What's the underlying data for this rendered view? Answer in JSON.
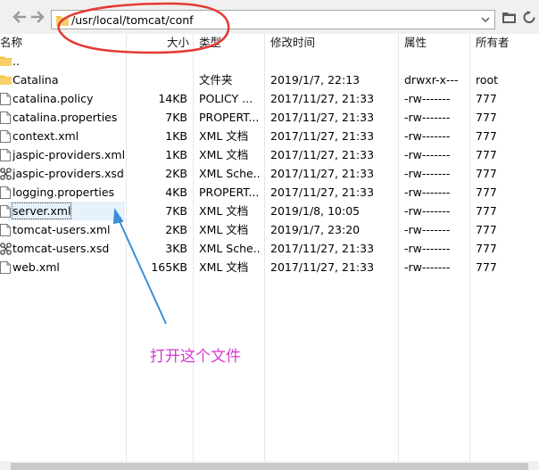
{
  "toolbar": {
    "back_icon": "arrow-left-icon",
    "forward_icon": "arrow-right-icon",
    "path": "/usr/local/tomcat/conf",
    "folder_icon": "folder-icon",
    "dropdown_icon": "chevron-down-icon",
    "browse_icon": "open-folder-icon",
    "refresh_icon": "refresh-icon"
  },
  "columns": {
    "name": "名称",
    "size": "大小",
    "type": "类型",
    "modified": "修改时间",
    "attributes": "属性",
    "owner": "所有者"
  },
  "files": [
    {
      "icon": "folder-icon",
      "name": "..",
      "size": "",
      "type": "",
      "modified": "",
      "attributes": "",
      "owner": ""
    },
    {
      "icon": "folder-icon",
      "name": "Catalina",
      "size": "",
      "type": "文件夹",
      "modified": "2019/1/7, 22:13",
      "attributes": "drwxr-x---",
      "owner": "root"
    },
    {
      "icon": "file-icon",
      "name": "catalina.policy",
      "size": "14KB",
      "type": "POLICY ...",
      "modified": "2017/11/27, 21:33",
      "attributes": "-rw-------",
      "owner": "777"
    },
    {
      "icon": "file-icon",
      "name": "catalina.properties",
      "size": "7KB",
      "type": "PROPERT...",
      "modified": "2017/11/27, 21:33",
      "attributes": "-rw-------",
      "owner": "777"
    },
    {
      "icon": "file-icon",
      "name": "context.xml",
      "size": "1KB",
      "type": "XML 文档",
      "modified": "2017/11/27, 21:33",
      "attributes": "-rw-------",
      "owner": "777"
    },
    {
      "icon": "file-icon",
      "name": "jaspic-providers.xml",
      "size": "1KB",
      "type": "XML 文档",
      "modified": "2017/11/27, 21:33",
      "attributes": "-rw-------",
      "owner": "777"
    },
    {
      "icon": "xsd-file-icon",
      "name": "jaspic-providers.xsd",
      "size": "2KB",
      "type": "XML Sche...",
      "modified": "2017/11/27, 21:33",
      "attributes": "-rw-------",
      "owner": "777"
    },
    {
      "icon": "file-icon",
      "name": "logging.properties",
      "size": "4KB",
      "type": "PROPERT...",
      "modified": "2017/11/27, 21:33",
      "attributes": "-rw-------",
      "owner": "777"
    },
    {
      "icon": "file-icon",
      "name": "server.xml",
      "size": "7KB",
      "type": "XML 文档",
      "modified": "2019/1/8, 10:05",
      "attributes": "-rw-------",
      "owner": "777"
    },
    {
      "icon": "file-icon",
      "name": "tomcat-users.xml",
      "size": "2KB",
      "type": "XML 文档",
      "modified": "2019/1/7, 23:20",
      "attributes": "-rw-------",
      "owner": "777"
    },
    {
      "icon": "xsd-file-icon",
      "name": "tomcat-users.xsd",
      "size": "3KB",
      "type": "XML Sche...",
      "modified": "2017/11/27, 21:33",
      "attributes": "-rw-------",
      "owner": "777"
    },
    {
      "icon": "file-icon",
      "name": "web.xml",
      "size": "165KB",
      "type": "XML 文档",
      "modified": "2017/11/27, 21:33",
      "attributes": "-rw-------",
      "owner": "777"
    }
  ],
  "selected_row": 8,
  "annotation": {
    "text": "打开这个文件",
    "color": "#d23bd2",
    "circle_color": "#e53935",
    "arrow_color": "#3b8fd8"
  },
  "colors": {
    "selection": "#e5f1fb",
    "folder": "#f5c542"
  }
}
